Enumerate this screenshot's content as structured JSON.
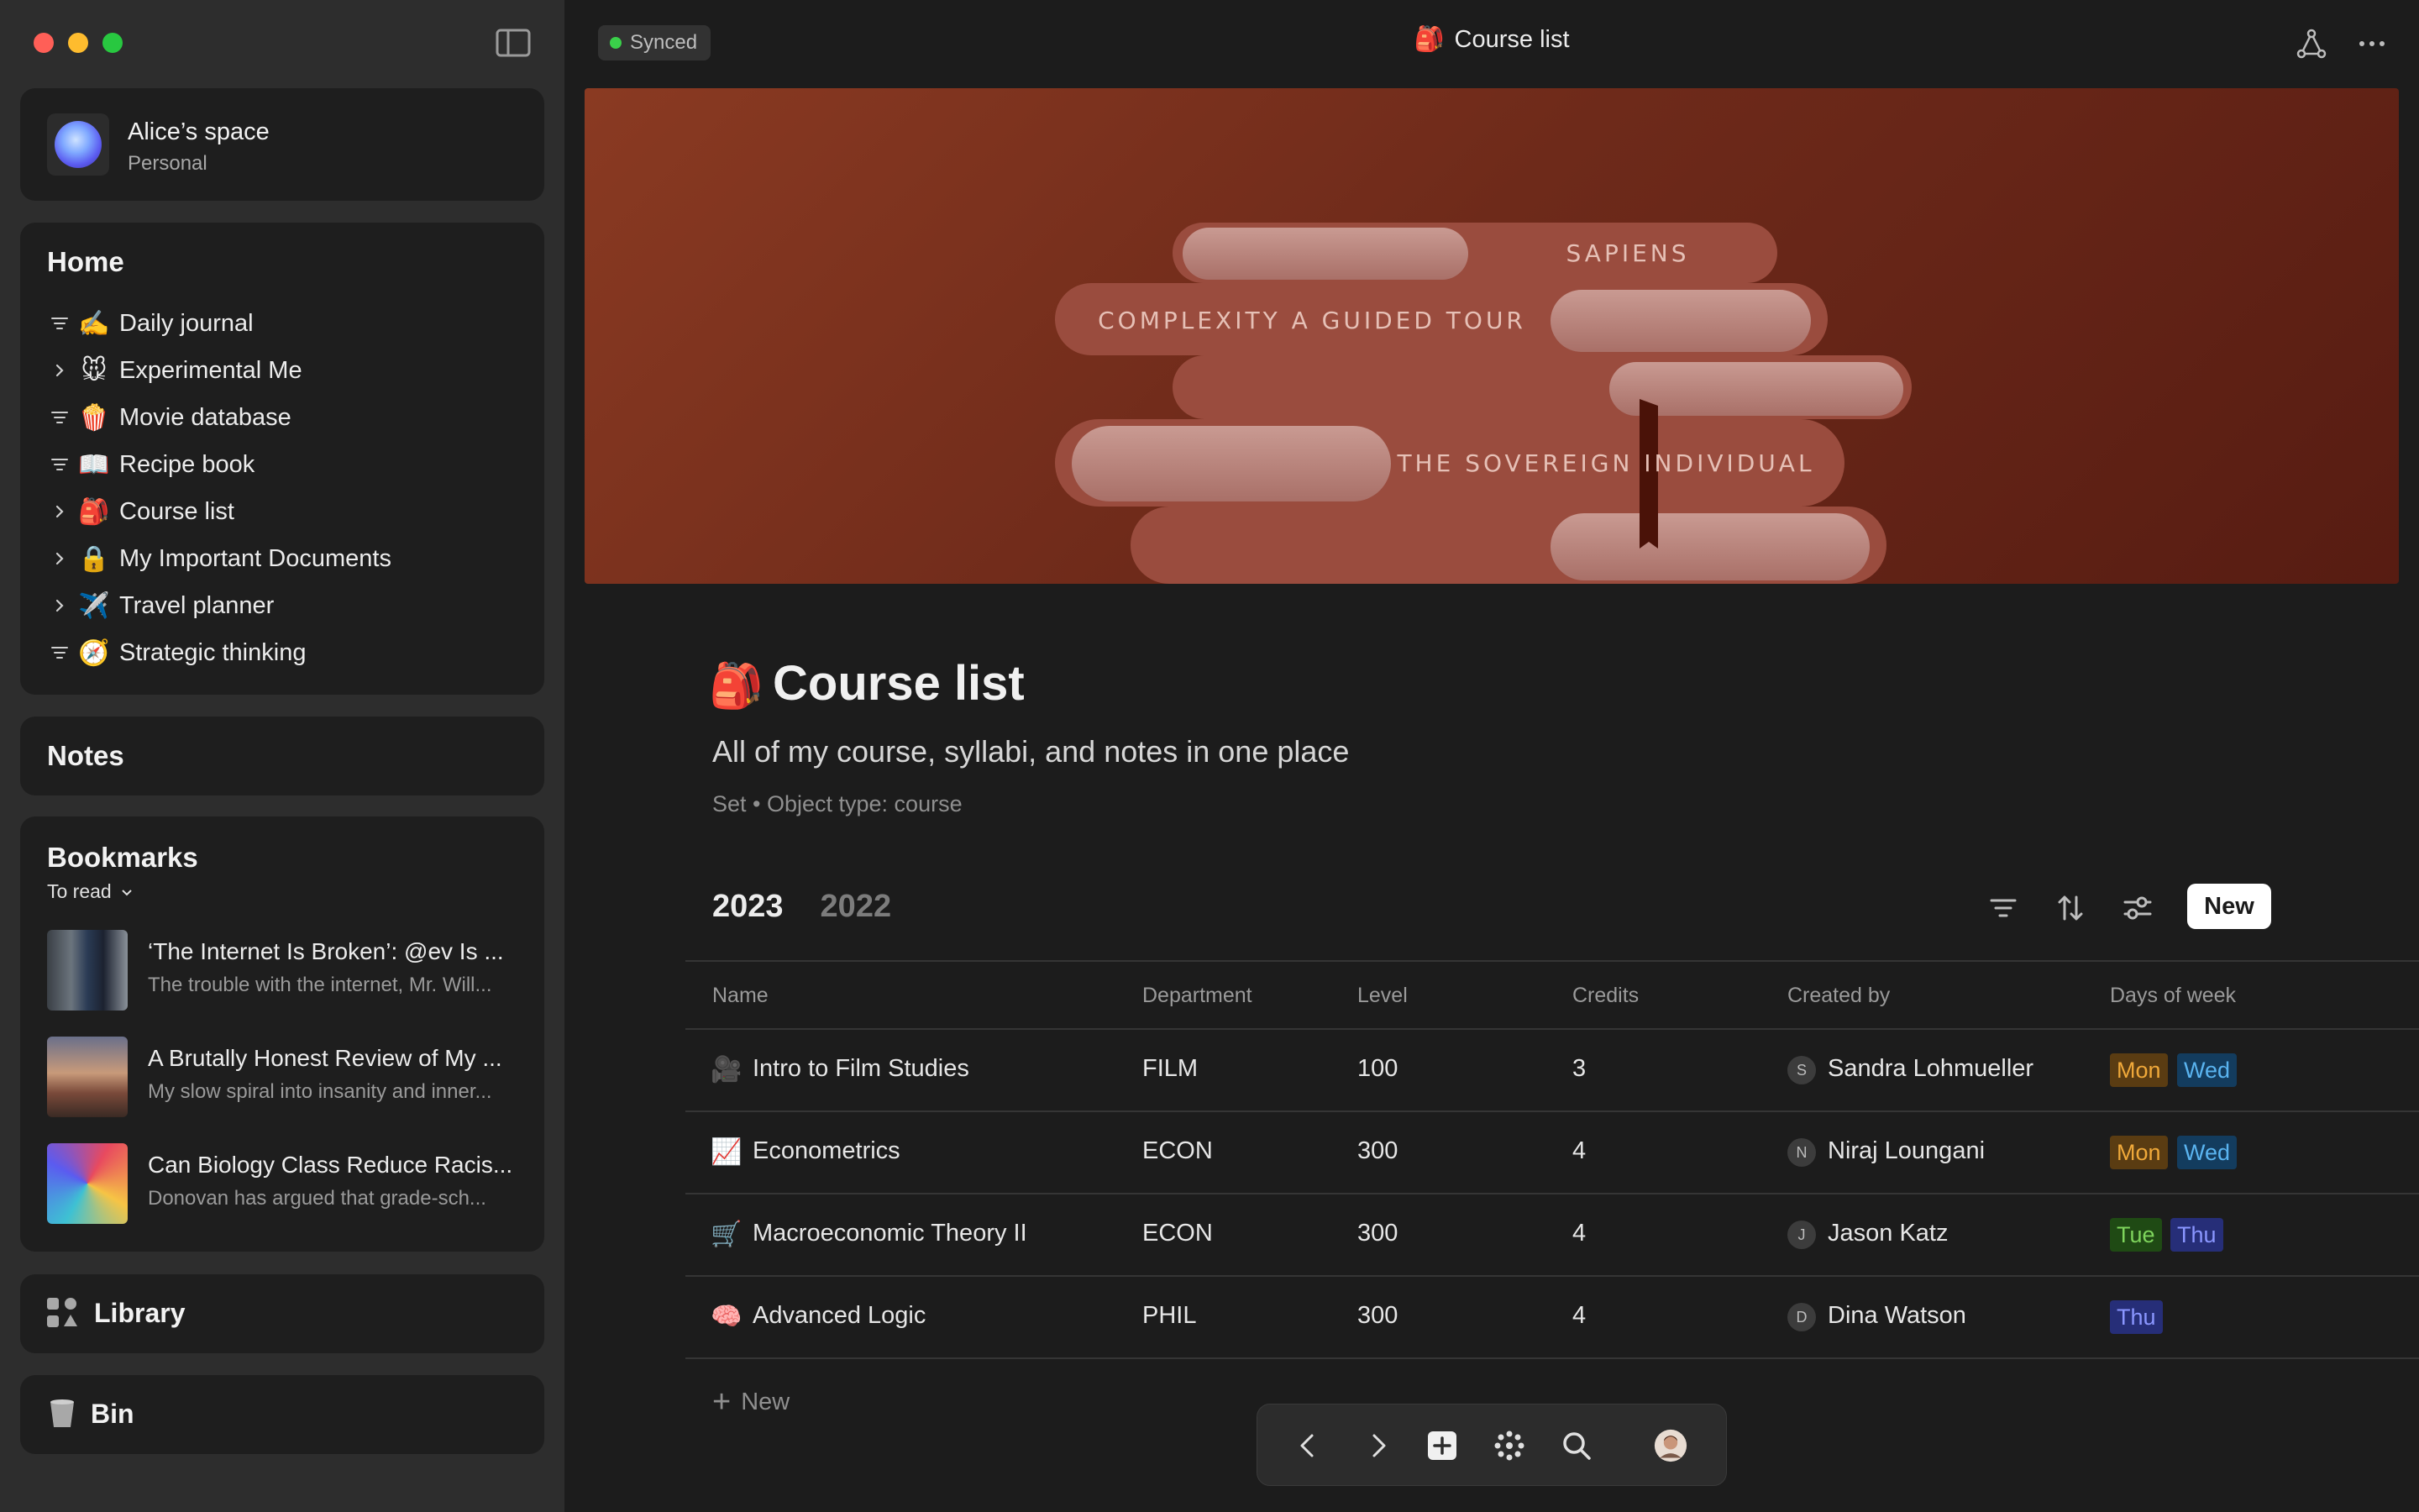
{
  "window": {
    "traffic_lights": [
      "close",
      "minimize",
      "zoom"
    ]
  },
  "space": {
    "name": "Alice’s space",
    "subtitle": "Personal"
  },
  "home": {
    "title": "Home",
    "items": [
      {
        "label": "Daily journal",
        "emoji": "✍️",
        "marker": "filter"
      },
      {
        "label": "Experimental Me",
        "emoji": "🐭",
        "marker": "chevron"
      },
      {
        "label": "Movie database",
        "emoji": "🍿",
        "marker": "filter"
      },
      {
        "label": "Recipe book",
        "emoji": "📖",
        "marker": "filter"
      },
      {
        "label": "Course list",
        "emoji": "🎒",
        "marker": "chevron"
      },
      {
        "label": "My Important Documents",
        "emoji": "🔒",
        "marker": "chevron"
      },
      {
        "label": "Travel planner",
        "emoji": "✈️",
        "marker": "chevron"
      },
      {
        "label": "Strategic thinking",
        "emoji": "🧭",
        "marker": "filter"
      }
    ]
  },
  "notes": {
    "title": "Notes"
  },
  "bookmarks": {
    "title": "Bookmarks",
    "filter": "To read",
    "items": [
      {
        "title": "‘The Internet Is Broken’: @ev Is ...",
        "desc": "The trouble with the internet, Mr. Will..."
      },
      {
        "title": "A Brutally Honest Review of My ...",
        "desc": "My slow spiral into insanity and inner..."
      },
      {
        "title": "Can Biology Class Reduce Racis...",
        "desc": "Donovan has argued that grade-sch..."
      }
    ]
  },
  "library": {
    "label": "Library"
  },
  "bin": {
    "label": "Bin"
  },
  "topbar": {
    "status": "Synced",
    "title": "Course list",
    "title_emoji": "🎒"
  },
  "cover": {
    "books": [
      "SAPIENS",
      "COMPLEXITY A GUIDED TOUR",
      "THE SOVEREIGN INDIVIDUAL"
    ]
  },
  "page": {
    "emoji": "🎒",
    "title": "Course list",
    "description": "All of my course, syllabi, and notes in one place",
    "meta": "Set  • Object type: course"
  },
  "tabs": [
    "2023",
    "2022"
  ],
  "toolbar": {
    "new_label": "New"
  },
  "table": {
    "columns": [
      "Name",
      "Department",
      "Level",
      "Credits",
      "Created by",
      "Days of week"
    ],
    "rows": [
      {
        "emoji": "🎥",
        "name": "Intro to Film Studies",
        "dept": "FILM",
        "level": "100",
        "credits": "3",
        "creator_initial": "S",
        "creator": "Sandra Lohmueller",
        "days": [
          "Mon",
          "Wed"
        ]
      },
      {
        "emoji": "📈",
        "name": "Econometrics",
        "dept": "ECON",
        "level": "300",
        "credits": "4",
        "creator_initial": "N",
        "creator": "Niraj Loungani",
        "days": [
          "Mon",
          "Wed"
        ]
      },
      {
        "emoji": "🛒",
        "name": "Macroeconomic Theory II",
        "dept": "ECON",
        "level": "300",
        "credits": "4",
        "creator_initial": "J",
        "creator": "Jason Katz",
        "days": [
          "Tue",
          "Thu"
        ]
      },
      {
        "emoji": "🧠",
        "name": "Advanced Logic",
        "dept": "PHIL",
        "level": "300",
        "credits": "4",
        "creator_initial": "D",
        "creator": "Dina Watson",
        "days": [
          "Thu"
        ]
      }
    ],
    "add_new_label": "New"
  },
  "nav": {
    "icons": [
      "chevron-left-icon",
      "chevron-right-icon",
      "plus-square-icon",
      "graph-dots-icon",
      "search-icon",
      "profile-avatar"
    ]
  },
  "colors": {
    "accent_mon": "#f0a93a",
    "accent_wed": "#5ab4f0",
    "accent_tue": "#7ed45c",
    "accent_thu": "#8a96ff",
    "synced": "#3ad04a",
    "cover": "#7a301c"
  }
}
